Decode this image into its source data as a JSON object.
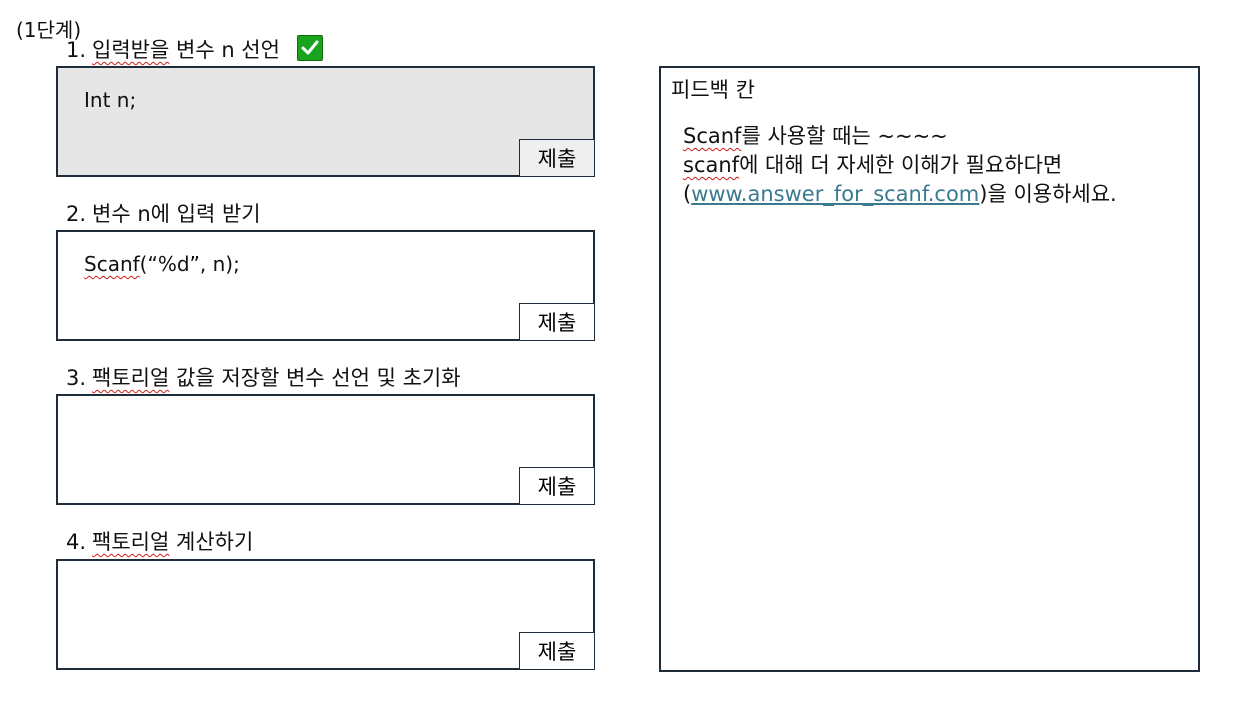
{
  "stage_label": "(1단계)",
  "questions": [
    {
      "number": "1.",
      "title_squiggle": "입력받을",
      "title_rest": " 변수 n 선언",
      "answer": "Int n;",
      "completed": true,
      "submit_label": "제출"
    },
    {
      "number": "2.",
      "title_squiggle": "",
      "title_rest": "변수 n에 입력 받기",
      "answer_squiggle": "Scanf",
      "answer_rest": "(“%d”, n);",
      "submit_label": "제출"
    },
    {
      "number": "3.",
      "title_squiggle": "팩토리얼",
      "title_rest": " 값을 저장할 변수 선언 및 초기화",
      "answer": "",
      "submit_label": "제출"
    },
    {
      "number": "4.",
      "title_squiggle": "팩토리얼",
      "title_rest": " 계산하기",
      "answer": "",
      "submit_label": "제출"
    }
  ],
  "feedback": {
    "title": "피드백 칸",
    "line1_squiggle": "Scanf",
    "line1_rest": "를 사용할 때는 ~~~~",
    "line2_squiggle": "scanf",
    "line2_rest": "에 대해 더 자세한 이해가 필요하다면",
    "line3_open": "(",
    "link_text": "www.answer_for_scanf.com",
    "line3_rest": ")을 이용하세요."
  },
  "colors": {
    "check": "#1aa31f",
    "link": "#3a7a90",
    "border": "#1f2d3a",
    "filled_box": "#e6e6e6"
  },
  "icons": {
    "completed": "checkmark-icon"
  }
}
